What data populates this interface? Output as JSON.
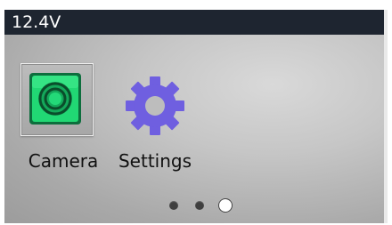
{
  "status_bar": {
    "voltage": "12.4V"
  },
  "apps": [
    {
      "label": "Camera",
      "icon": "camera-icon",
      "selected": true,
      "accent": "#22e07a"
    },
    {
      "label": "Settings",
      "icon": "gear-icon",
      "selected": false,
      "accent": "#6f5fe0"
    }
  ],
  "pager": {
    "pages": 3,
    "current_page": 3
  }
}
